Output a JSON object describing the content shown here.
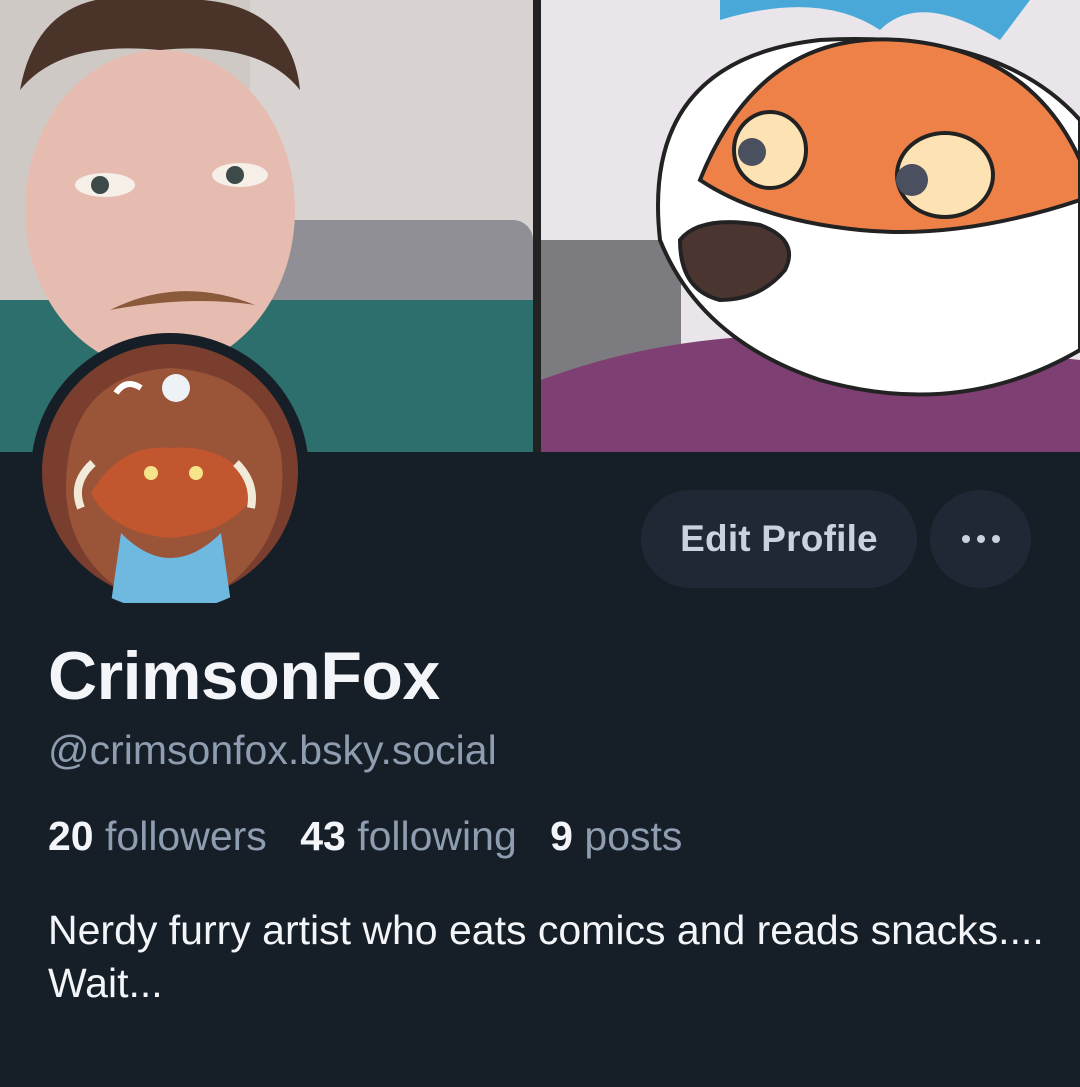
{
  "profile": {
    "display_name": "CrimsonFox",
    "handle": "@crimsonfox.bsky.social",
    "bio": "Nerdy furry artist who eats comics and reads snacks.... Wait..."
  },
  "stats": {
    "followers_count": "20",
    "followers_label": "followers",
    "following_count": "43",
    "following_label": "following",
    "posts_count": "9",
    "posts_label": "posts"
  },
  "actions": {
    "edit_profile_label": "Edit Profile",
    "more_icon": "ellipsis-icon"
  },
  "colors": {
    "background": "#161e27",
    "button_bg": "#1e2935",
    "muted_text": "#8e9db0",
    "primary_text": "#f3f5f8"
  }
}
